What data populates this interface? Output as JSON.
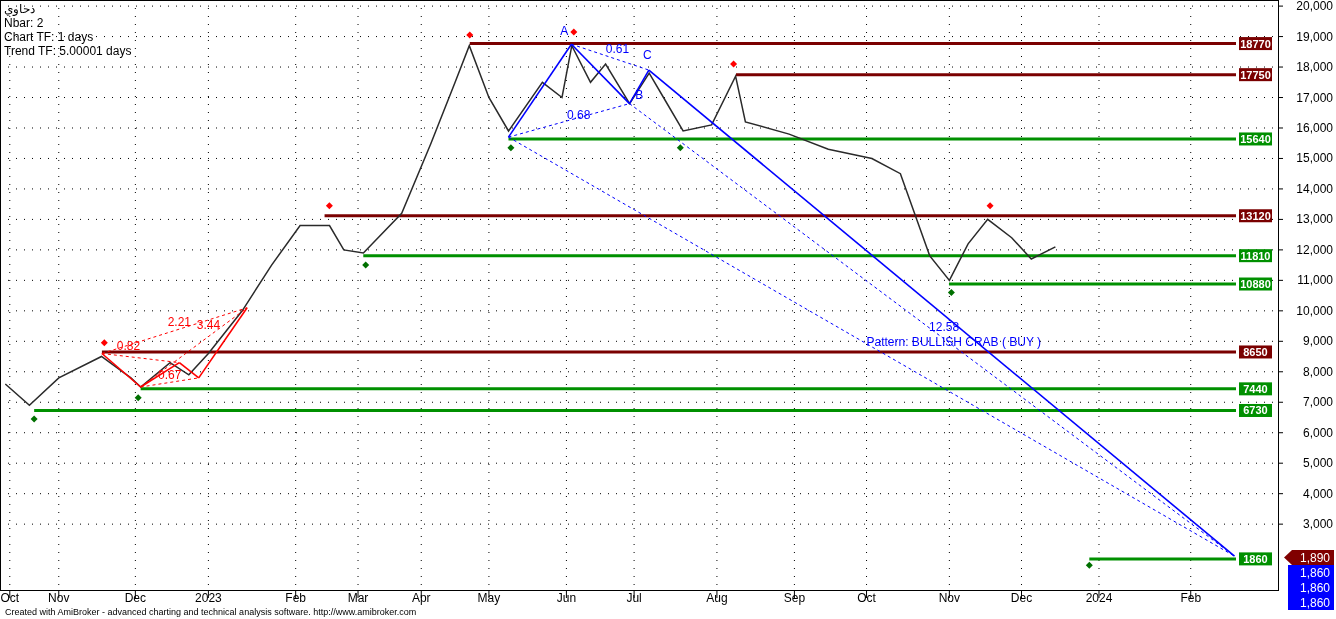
{
  "legend": {
    "symbol": "دحاوي",
    "lines": [
      "Nbar: 2",
      "Chart TF: 1 days",
      "Trend TF: 5.00001 days"
    ]
  },
  "chart": {
    "chart_data": {
      "type": "line",
      "grid": true,
      "xlim": [
        2022.766,
        2024.201
      ],
      "ylim": [
        839,
        20200
      ],
      "xticks": [
        {
          "value": 2022.777,
          "label": "Oct"
        },
        {
          "value": 2022.832,
          "label": "Nov"
        },
        {
          "value": 2022.918,
          "label": "Dec"
        },
        {
          "value": 2023,
          "label": "2023"
        },
        {
          "value": 2023.098,
          "label": "Feb"
        },
        {
          "value": 2023.168,
          "label": "Mar"
        },
        {
          "value": 2023.239,
          "label": "Apr"
        },
        {
          "value": 2023.315,
          "label": "May"
        },
        {
          "value": 2023.402,
          "label": "Jun"
        },
        {
          "value": 2023.478,
          "label": "Jul"
        },
        {
          "value": 2023.571,
          "label": "Aug"
        },
        {
          "value": 2023.658,
          "label": "Sep"
        },
        {
          "value": 2023.739,
          "label": "Oct"
        },
        {
          "value": 2023.832,
          "label": "Nov"
        },
        {
          "value": 2023.913,
          "label": "Dec"
        },
        {
          "value": 2024,
          "label": "2024"
        },
        {
          "value": 2024.103,
          "label": "Feb"
        }
      ],
      "yticks": [
        {
          "value": 3000,
          "label": "3,000"
        },
        {
          "value": 4000,
          "label": "4,000"
        },
        {
          "value": 5000,
          "label": "5,000"
        },
        {
          "value": 6000,
          "label": "6,000"
        },
        {
          "value": 7000,
          "label": "7,000"
        },
        {
          "value": 8000,
          "label": "8,000"
        },
        {
          "value": 9000,
          "label": "9,000"
        },
        {
          "value": 10000,
          "label": "10,000"
        },
        {
          "value": 11000,
          "label": "11,000"
        },
        {
          "value": 12000,
          "label": "12,000"
        },
        {
          "value": 13000,
          "label": "13,000"
        },
        {
          "value": 14000,
          "label": "14,000"
        },
        {
          "value": 15000,
          "label": "15,000"
        },
        {
          "value": 16000,
          "label": "16,000"
        },
        {
          "value": 17000,
          "label": "17,000"
        },
        {
          "value": 18000,
          "label": "18,000"
        },
        {
          "value": 19000,
          "label": "19,000"
        },
        {
          "value": 20000,
          "label": "20,000"
        }
      ],
      "x": [
        2022.772,
        2022.799,
        2022.832,
        2022.88,
        2022.913,
        2022.924,
        2022.957,
        2022.978,
        2023,
        2023.038,
        2023.071,
        2023.103,
        2023.136,
        2023.152,
        2023.174,
        2023.217,
        2023.25,
        2023.277,
        2023.293,
        2023.315,
        2023.337,
        2023.375,
        2023.397,
        2023.408,
        2023.429,
        2023.446,
        2023.473,
        2023.495,
        2023.511,
        2023.533,
        2023.565,
        2023.592,
        2023.603,
        2023.652,
        2023.696,
        2023.745,
        2023.777,
        2023.81,
        2023.832,
        2023.853,
        2023.875,
        2023.902,
        2023.924,
        2023.951
      ],
      "series": [
        {
          "color": "#2a2a2a",
          "values": [
            7600,
            6900,
            7800,
            8500,
            7800,
            7500,
            8300,
            7900,
            8600,
            10000,
            11500,
            12800,
            12800,
            12000,
            11900,
            13200,
            15500,
            17500,
            18700,
            17000,
            15900,
            17500,
            17000,
            18700,
            17500,
            18100,
            16800,
            17800,
            17000,
            15900,
            16100,
            17700,
            16200,
            15800,
            15300,
            15000,
            14500,
            11800,
            11000,
            12200,
            13000,
            12400,
            11700,
            12100
          ]
        }
      ],
      "ref_lines": [
        {
          "axis": "y",
          "value": 18770,
          "label": "18770",
          "color": "#7a0000"
        },
        {
          "axis": "y",
          "value": 17750,
          "label": "17750",
          "color": "#7a0000"
        },
        {
          "axis": "y",
          "value": 15640,
          "label": "15640",
          "color": "#009000"
        },
        {
          "axis": "y",
          "value": 13120,
          "label": "13120",
          "color": "#7a0000"
        },
        {
          "axis": "y",
          "value": 11810,
          "label": "11810",
          "color": "#009000"
        },
        {
          "axis": "y",
          "value": 10880,
          "label": "10880",
          "color": "#009000"
        },
        {
          "axis": "y",
          "value": 8650,
          "label": "8650",
          "color": "#7a0000"
        },
        {
          "axis": "y",
          "value": 7440,
          "label": "7440",
          "color": "#009000"
        },
        {
          "axis": "y",
          "value": 6730,
          "label": "6730",
          "color": "#009000"
        },
        {
          "axis": "y",
          "value": 1860,
          "label": "1860",
          "color": "#009000"
        }
      ],
      "annotations": [
        "0.82",
        "2.21",
        "3.44",
        "0.67",
        "0.61",
        "0.68",
        "12.58",
        "A",
        "B",
        "C",
        "Pattern: BULLISH CRAB ( BUY )"
      ]
    }
  },
  "price_markers": [
    {
      "kind": "last",
      "label": "1,890"
    },
    {
      "kind": "other",
      "label": "1,860"
    },
    {
      "kind": "other",
      "label": "1,860"
    },
    {
      "kind": "other",
      "label": "1,860"
    }
  ],
  "footer": "Created with AmiBroker - advanced charting and technical analysis software. http://www.amibroker.com"
}
